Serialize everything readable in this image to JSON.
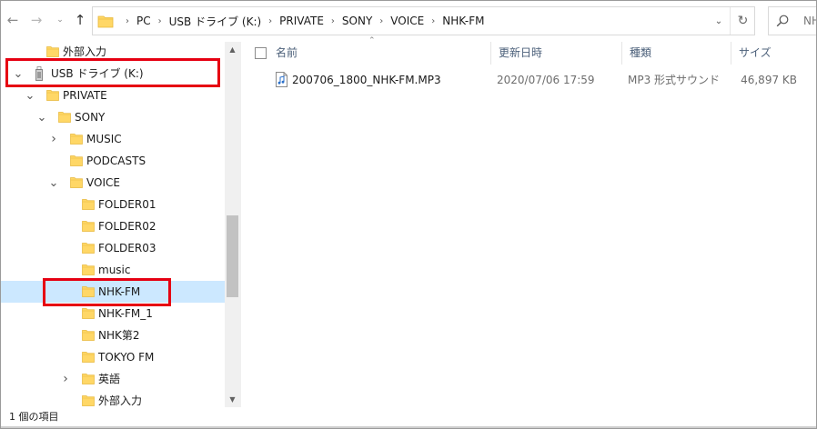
{
  "address_bar": {
    "crumbs": [
      "PC",
      "USB ドライブ (K:)",
      "PRIVATE",
      "SONY",
      "VOICE",
      "NHK-FM"
    ]
  },
  "search": {
    "placeholder": "NH"
  },
  "nav_tree": [
    {
      "label": "外部入力",
      "indent": 1,
      "expand": "none",
      "kind": "folder"
    },
    {
      "label": "USB ドライブ (K:)",
      "indent": 0,
      "expand": "open",
      "kind": "drive"
    },
    {
      "label": "PRIVATE",
      "indent": 1,
      "expand": "open",
      "kind": "folder"
    },
    {
      "label": "SONY",
      "indent": 2,
      "expand": "open",
      "kind": "folder"
    },
    {
      "label": "MUSIC",
      "indent": 3,
      "expand": "closed",
      "kind": "folder"
    },
    {
      "label": "PODCASTS",
      "indent": 3,
      "expand": "none",
      "kind": "folder"
    },
    {
      "label": "VOICE",
      "indent": 3,
      "expand": "open",
      "kind": "folder"
    },
    {
      "label": "FOLDER01",
      "indent": 4,
      "expand": "none",
      "kind": "folder"
    },
    {
      "label": "FOLDER02",
      "indent": 4,
      "expand": "none",
      "kind": "folder"
    },
    {
      "label": "FOLDER03",
      "indent": 4,
      "expand": "none",
      "kind": "folder"
    },
    {
      "label": "music",
      "indent": 4,
      "expand": "none",
      "kind": "folder"
    },
    {
      "label": "NHK-FM",
      "indent": 4,
      "expand": "none",
      "kind": "folder",
      "selected": true
    },
    {
      "label": "NHK-FM_1",
      "indent": 4,
      "expand": "none",
      "kind": "folder"
    },
    {
      "label": "NHK第2",
      "indent": 4,
      "expand": "none",
      "kind": "folder"
    },
    {
      "label": "TOKYO FM",
      "indent": 4,
      "expand": "none",
      "kind": "folder"
    },
    {
      "label": "英語",
      "indent": 4,
      "expand": "closed",
      "kind": "folder"
    },
    {
      "label": "外部入力",
      "indent": 4,
      "expand": "none",
      "kind": "folder"
    }
  ],
  "columns": [
    "名前",
    "更新日時",
    "種類",
    "サイズ"
  ],
  "files": [
    {
      "name": "200706_1800_NHK-FM.MP3",
      "modified": "2020/07/06 17:59",
      "type": "MP3 形式サウンド",
      "size": "46,897 KB"
    }
  ],
  "status": {
    "item_count": "1 個の項目"
  },
  "colors": {
    "folder": "#ffd766",
    "folder_edge": "#e8b83a",
    "selection": "#cce8ff",
    "annotation": "#e60012"
  },
  "icons": [
    "back-arrow-icon",
    "forward-arrow-icon",
    "recent-chevron-icon",
    "up-arrow-icon",
    "folder-icon",
    "refresh-icon",
    "search-icon",
    "usb-drive-icon",
    "mp3-file-icon"
  ]
}
